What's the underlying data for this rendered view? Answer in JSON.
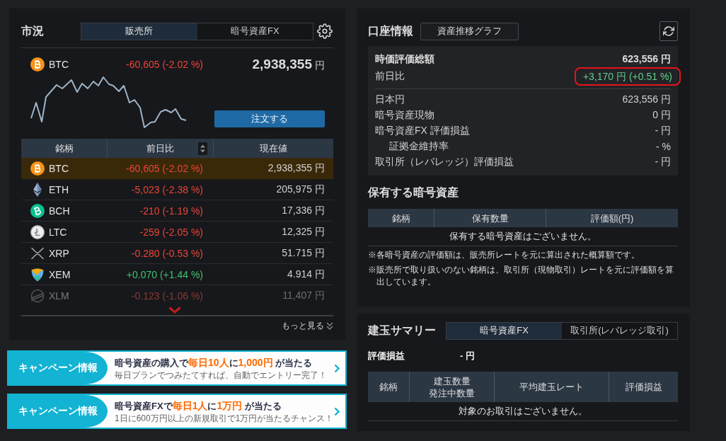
{
  "market": {
    "title": "市況",
    "tabs": [
      {
        "label": "販売所",
        "selected": true
      },
      {
        "label": "暗号資産FX",
        "selected": false
      }
    ],
    "featured": {
      "kind": "bitcoin",
      "symbol": "BTC",
      "change": "-60,605 (-2.02 %)",
      "color": "#ec4438",
      "price": "2,938,355",
      "unit": "円"
    },
    "order_button": "注文する",
    "table": {
      "columns": [
        {
          "label": "銘柄",
          "sortable": false
        },
        {
          "label": "前日比",
          "sortable": true
        },
        {
          "label": "現在値",
          "sortable": false
        }
      ],
      "rows": [
        {
          "kind": "bitcoin",
          "symbol": "BTC",
          "change": "-60,605 (-2.02 %)",
          "color": "#ec4438",
          "price": "2,938,355 円",
          "selected": true,
          "faded": false
        },
        {
          "kind": "ethereum",
          "symbol": "ETH",
          "change": "-5,023 (-2.38 %)",
          "color": "#ec4438",
          "price": "205,975 円",
          "selected": false,
          "faded": false
        },
        {
          "kind": "bitcoincash",
          "symbol": "BCH",
          "change": "-210 (-1.19 %)",
          "color": "#ec4438",
          "price": "17,336 円",
          "selected": false,
          "faded": false
        },
        {
          "kind": "litecoin",
          "symbol": "LTC",
          "change": "-259 (-2.05 %)",
          "color": "#ec4438",
          "price": "12,325 円",
          "selected": false,
          "faded": false
        },
        {
          "kind": "xrp",
          "symbol": "XRP",
          "change": "-0.280 (-0.53 %)",
          "color": "#ec4438",
          "price": "51.715 円",
          "selected": false,
          "faded": false
        },
        {
          "kind": "nem",
          "symbol": "XEM",
          "change": "+0.070 (+1.44 %)",
          "color": "#3fc46f",
          "price": "4.914 円",
          "selected": false,
          "faded": false
        },
        {
          "kind": "stellar",
          "symbol": "XLM",
          "change": "-0.123 (-1.06 %)",
          "color": "#8a3a35",
          "price": "11,407 円",
          "selected": false,
          "faded": true
        }
      ]
    },
    "more_link": "もっと見る"
  },
  "banners": [
    {
      "tag": "キャンペーン情報",
      "title": "暗号資産の購入で**毎日10人**に**1,000円** が当たる",
      "subtitle": "毎日プランでつみたてすれば、自動でエントリー完了！"
    },
    {
      "tag": "キャンペーン情報",
      "title": "暗号資産FXで**毎日1人**に**1万円** が当たる",
      "subtitle": "1日に600万円以上の新規取引で1万円が当たるチャンス！"
    }
  ],
  "account": {
    "title": "口座情報",
    "graph_button": "資産推移グラフ",
    "total": {
      "label": "時価評価総額",
      "value": "623,556 円"
    },
    "change": {
      "label": "前日比",
      "value": "+3,170 円 (+0.51 %)",
      "color": "#5fd08c",
      "highlighted": true
    },
    "breakdown": [
      {
        "label": "日本円",
        "value": "623,556 円"
      },
      {
        "label": "暗号資産現物",
        "value": "0 円"
      },
      {
        "label": "暗号資産FX 評価損益",
        "value": "- 円",
        "children": [
          {
            "label": "証拠金維持率",
            "value": "- %"
          }
        ]
      },
      {
        "label": "取引所（レバレッジ）評価損益",
        "value": "- 円"
      }
    ]
  },
  "holdings": {
    "title": "保有する暗号資産",
    "columns": [
      {
        "lines": [
          "銘柄"
        ]
      },
      {
        "lines": [
          "保有数量"
        ]
      },
      {
        "lines": [
          "評価額(円)"
        ]
      }
    ],
    "empty_message": "保有する暗号資産はございません。",
    "notes": [
      "※各暗号資産の評価額は、販売所レートを元に算出された概算額です。",
      "※販売所で取り扱いのない銘柄は、取引所（現物取引）レートを元に評価額を算出しています。"
    ]
  },
  "positions": {
    "title": "建玉サマリー",
    "tabs": [
      {
        "label": "暗号資産FX",
        "selected": true
      },
      {
        "label": "取引所(レバレッジ取引)",
        "selected": false
      }
    ],
    "pl_label": "評価損益",
    "pl_value": "- 円",
    "columns": [
      {
        "lines": [
          "銘柄"
        ]
      },
      {
        "lines": [
          "建玉数量",
          "発注中数量"
        ]
      },
      {
        "lines": [
          "平均建玉レート"
        ]
      },
      {
        "lines": [
          "評価損益"
        ]
      }
    ],
    "empty_message": "対象のお取引はございません。"
  }
}
